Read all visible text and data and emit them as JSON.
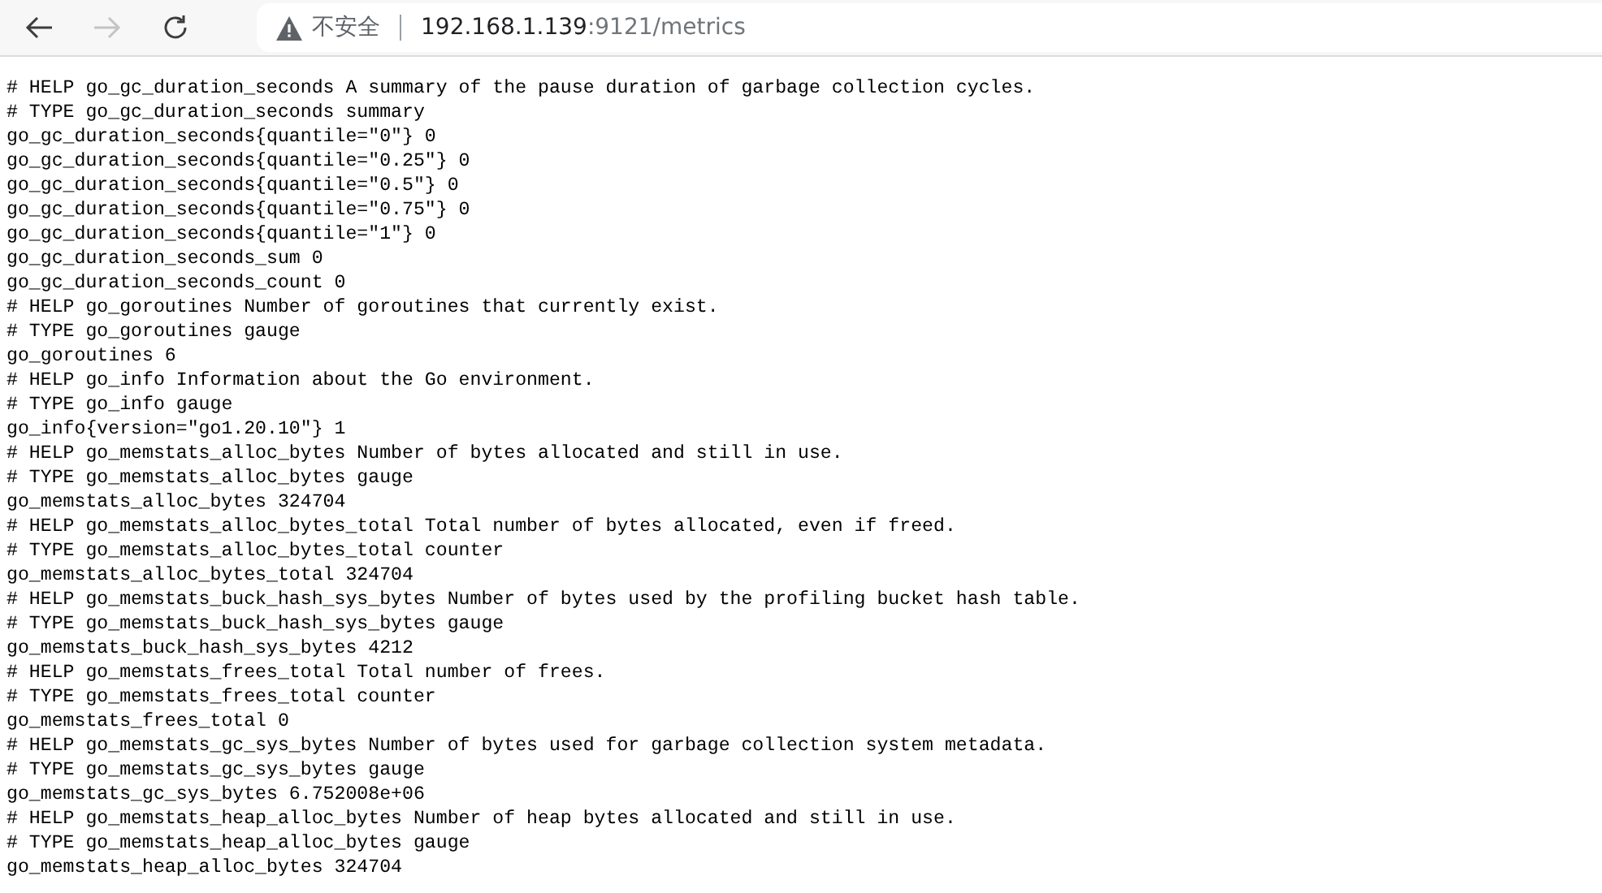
{
  "toolbar": {
    "back_disabled": false,
    "forward_disabled": true,
    "security_label": "不安全",
    "url_host": "192.168.1.139",
    "url_rest": ":9121/metrics"
  },
  "lines": [
    "# HELP go_gc_duration_seconds A summary of the pause duration of garbage collection cycles.",
    "# TYPE go_gc_duration_seconds summary",
    "go_gc_duration_seconds{quantile=\"0\"} 0",
    "go_gc_duration_seconds{quantile=\"0.25\"} 0",
    "go_gc_duration_seconds{quantile=\"0.5\"} 0",
    "go_gc_duration_seconds{quantile=\"0.75\"} 0",
    "go_gc_duration_seconds{quantile=\"1\"} 0",
    "go_gc_duration_seconds_sum 0",
    "go_gc_duration_seconds_count 0",
    "# HELP go_goroutines Number of goroutines that currently exist.",
    "# TYPE go_goroutines gauge",
    "go_goroutines 6",
    "# HELP go_info Information about the Go environment.",
    "# TYPE go_info gauge",
    "go_info{version=\"go1.20.10\"} 1",
    "# HELP go_memstats_alloc_bytes Number of bytes allocated and still in use.",
    "# TYPE go_memstats_alloc_bytes gauge",
    "go_memstats_alloc_bytes 324704",
    "# HELP go_memstats_alloc_bytes_total Total number of bytes allocated, even if freed.",
    "# TYPE go_memstats_alloc_bytes_total counter",
    "go_memstats_alloc_bytes_total 324704",
    "# HELP go_memstats_buck_hash_sys_bytes Number of bytes used by the profiling bucket hash table.",
    "# TYPE go_memstats_buck_hash_sys_bytes gauge",
    "go_memstats_buck_hash_sys_bytes 4212",
    "# HELP go_memstats_frees_total Total number of frees.",
    "# TYPE go_memstats_frees_total counter",
    "go_memstats_frees_total 0",
    "# HELP go_memstats_gc_sys_bytes Number of bytes used for garbage collection system metadata.",
    "# TYPE go_memstats_gc_sys_bytes gauge",
    "go_memstats_gc_sys_bytes 6.752008e+06",
    "# HELP go_memstats_heap_alloc_bytes Number of heap bytes allocated and still in use.",
    "# TYPE go_memstats_heap_alloc_bytes gauge",
    "go_memstats_heap_alloc_bytes 324704"
  ]
}
